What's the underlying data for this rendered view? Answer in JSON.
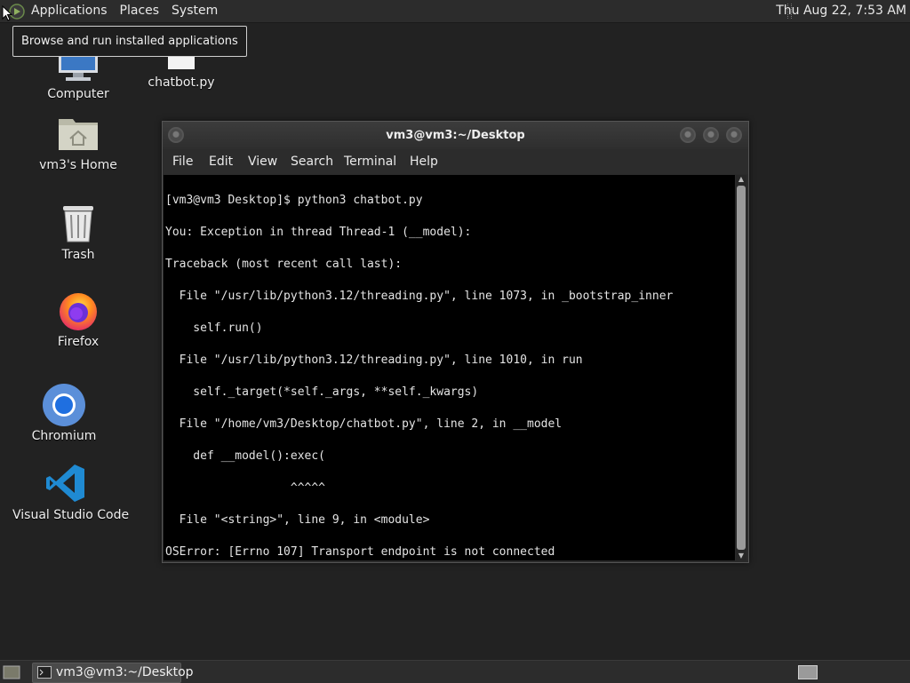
{
  "top_panel": {
    "menus": [
      "Applications",
      "Places",
      "System"
    ],
    "clock": "Thu Aug 22,  7:53 AM"
  },
  "tooltip": "Browse and run installed applications",
  "desktop_icons": [
    {
      "label": "Computer"
    },
    {
      "label": "chatbot.py"
    },
    {
      "label": "vm3's Home"
    },
    {
      "label": "Trash"
    },
    {
      "label": "Firefox"
    },
    {
      "label": "Chromium"
    },
    {
      "label": "Visual Studio Code"
    }
  ],
  "terminal": {
    "title": "vm3@vm3:~/Desktop",
    "menu": [
      "File",
      "Edit",
      "View",
      "Search",
      "Terminal",
      "Help"
    ],
    "lines": [
      "[vm3@vm3 Desktop]$ python3 chatbot.py",
      "You: Exception in thread Thread-1 (__model):",
      "Traceback (most recent call last):",
      "  File \"/usr/lib/python3.12/threading.py\", line 1073, in _bootstrap_inner",
      "    self.run()",
      "  File \"/usr/lib/python3.12/threading.py\", line 1010, in run",
      "    self._target(*self._args, **self._kwargs)",
      "  File \"/home/vm3/Desktop/chatbot.py\", line 2, in __model",
      "    def __model():exec(",
      "                  ^^^^^",
      "  File \"<string>\", line 9, in <module>",
      "OSError: [Errno 107] Transport endpoint is not connected"
    ]
  },
  "taskbar": {
    "task_label": "vm3@vm3:~/Desktop"
  }
}
